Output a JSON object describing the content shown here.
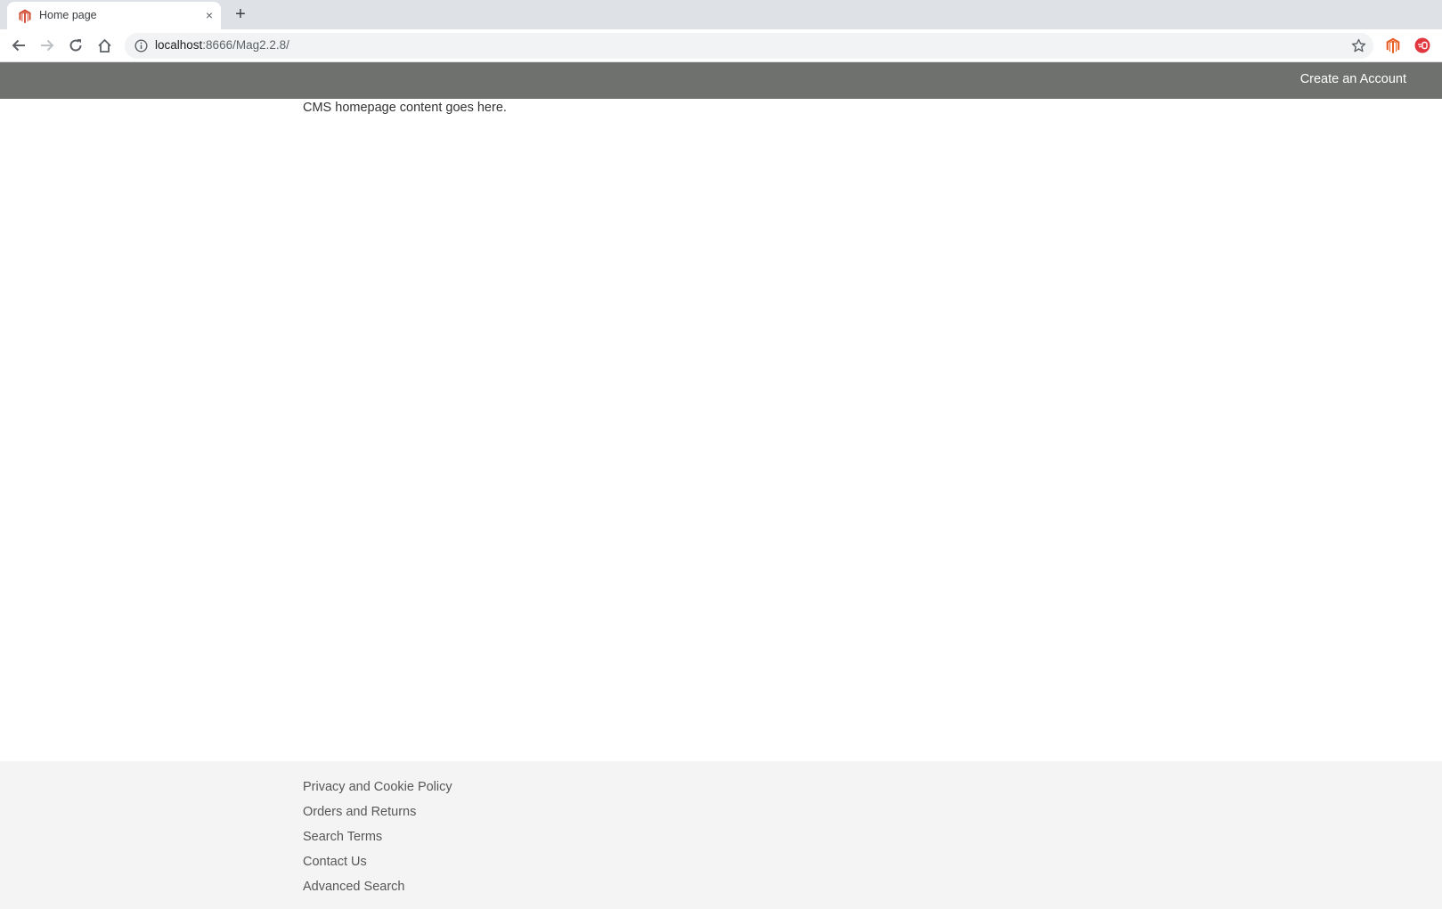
{
  "browser": {
    "tab": {
      "title": "Home page",
      "favicon": "magento-icon",
      "close_label": "×"
    },
    "new_tab_label": "+",
    "nav": {
      "back_icon": "back-arrow-icon",
      "forward_icon": "forward-arrow-icon",
      "reload_icon": "reload-icon",
      "home_icon": "home-icon"
    },
    "address_bar": {
      "host": "localhost",
      "rest": ":8666/Mag2.2.8/"
    },
    "extensions": [
      "magento-extension-icon",
      "red-circle-extension-icon"
    ]
  },
  "header": {
    "create_account_label": "Create an Account"
  },
  "main": {
    "cms_text": "CMS homepage content goes here."
  },
  "footer": {
    "links": [
      "Privacy and Cookie Policy",
      "Orders and Returns",
      "Search Terms",
      "Contact Us",
      "Advanced Search"
    ]
  },
  "colors": {
    "header_bg": "#6e716e",
    "footer_bg": "#f4f4f4",
    "magento_orange": "#e85d22",
    "tab_strip": "#dee1e6"
  }
}
